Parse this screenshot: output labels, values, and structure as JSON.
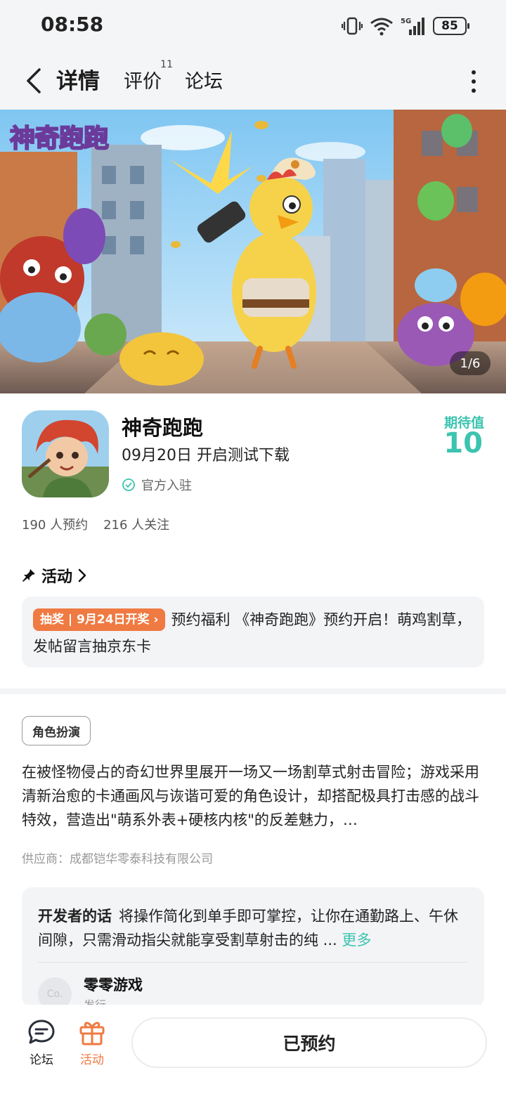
{
  "status_bar": {
    "time": "08:58",
    "network": "5G",
    "battery": "85"
  },
  "nav": {
    "tabs": [
      {
        "label": "详情",
        "active": true
      },
      {
        "label": "评价",
        "badge": "11"
      },
      {
        "label": "论坛"
      }
    ]
  },
  "banner": {
    "logo_text": "神奇跑跑",
    "counter": "1/6"
  },
  "game": {
    "name": "神奇跑跑",
    "test_date": "09月20日 开启测试下载",
    "official": "官方入驻",
    "expect_label": "期待值",
    "expect_value": "10",
    "reservations": "190 人预约",
    "followers": "216 人关注"
  },
  "activity": {
    "title": "活动",
    "tag": "抽奖 | 9月24日开奖 ›",
    "text": "预约福利 《神奇跑跑》预约开启！萌鸡割草，发帖留言抽京东卡"
  },
  "description": {
    "genre": "角色扮演",
    "text": "在被怪物侵占的奇幻世界里展开一场又一场割草式射击冒险；游戏采用清新治愈的卡通画风与诙谐可爱的角色设计，却搭配极具打击感的战斗特效，营造出\"萌系外表+硬核内核\"的反差魅力，…",
    "supplier": "供应商：成都铠华零泰科技有限公司"
  },
  "developer": {
    "heading": "开发者的话",
    "text": "将操作简化到单手即可掌控，让你在通勤路上、午休间隙，只需滑动指尖就能享受割草射击的纯 ...",
    "more": "更多",
    "avatar_text": "Co.",
    "name": "零零游戏",
    "role": "发行"
  },
  "bottom_bar": {
    "forum_label": "论坛",
    "activity_label": "活动",
    "reserve_button": "已预约"
  },
  "colors": {
    "accent": "#3cc4b0",
    "activity_orange": "#ef7a42"
  }
}
